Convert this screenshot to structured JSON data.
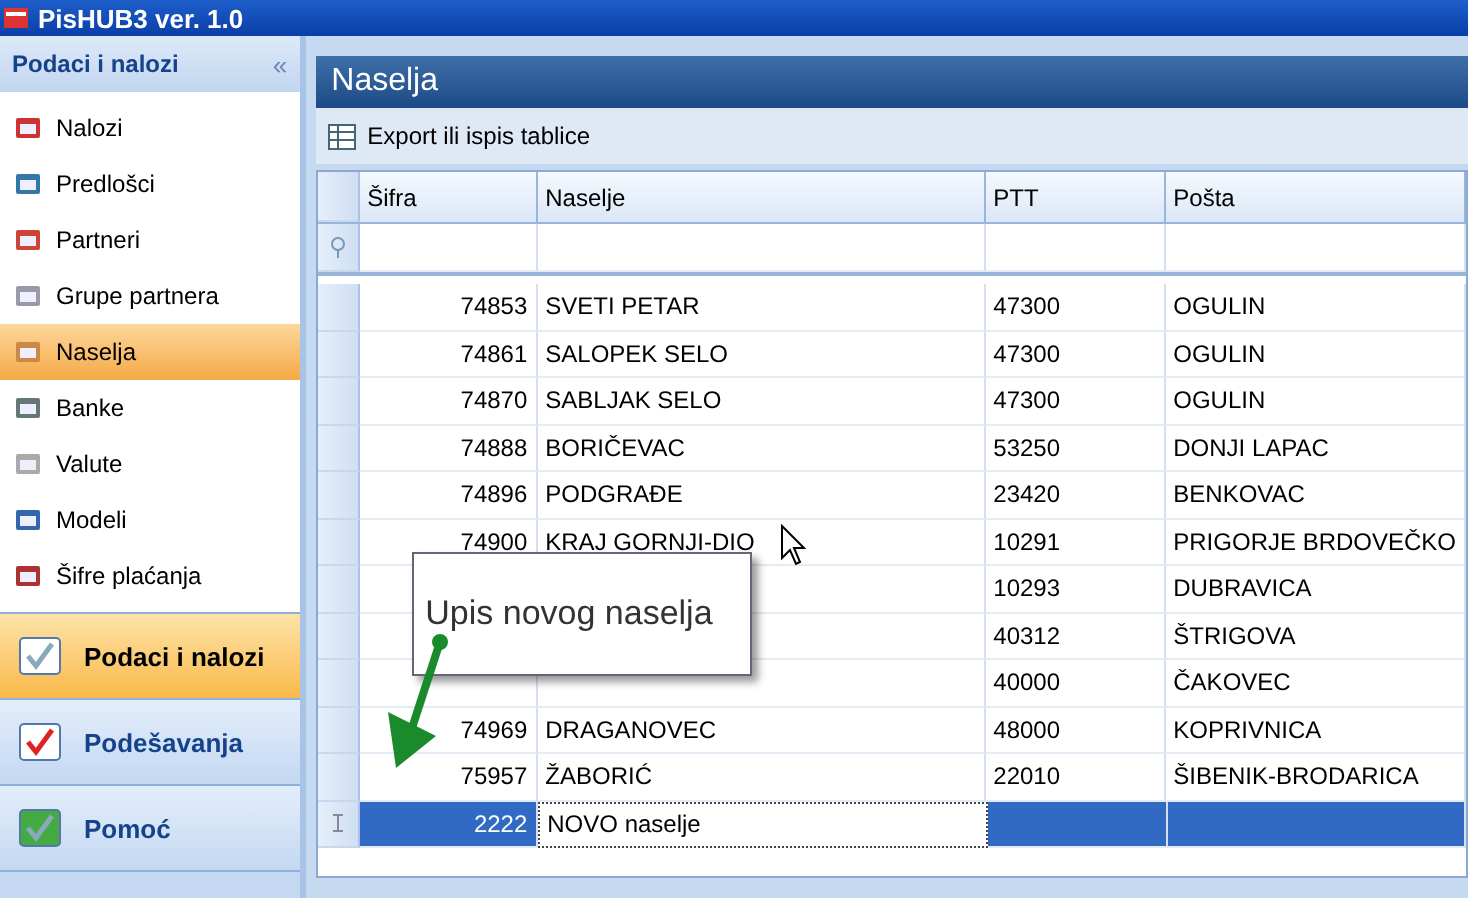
{
  "app": {
    "title": "PisHUB3 ver. 1.0"
  },
  "sidebar": {
    "header": "Podaci i nalozi",
    "collapse": "«",
    "items": [
      {
        "label": "Nalozi",
        "selected": false
      },
      {
        "label": "Predlošci",
        "selected": false
      },
      {
        "label": "Partneri",
        "selected": false
      },
      {
        "label": "Grupe partnera",
        "selected": false
      },
      {
        "label": "Naselja",
        "selected": true
      },
      {
        "label": "Banke",
        "selected": false
      },
      {
        "label": "Valute",
        "selected": false
      },
      {
        "label": "Modeli",
        "selected": false
      },
      {
        "label": "Šifre plaćanja",
        "selected": false
      }
    ],
    "sections": [
      {
        "label": "Podaci i nalozi",
        "selected": true
      },
      {
        "label": "Podešavanja",
        "selected": false
      },
      {
        "label": "Pomoć",
        "selected": false
      }
    ]
  },
  "panel": {
    "title": "Naselja",
    "export": "Export ili ispis tablice"
  },
  "table": {
    "columns": [
      "Šifra",
      "Naselje",
      "PTT",
      "Pošta"
    ],
    "rows": [
      {
        "sifra": "74853",
        "naselje": "SVETI PETAR",
        "ptt": "47300",
        "posta": "OGULIN",
        "selected": false
      },
      {
        "sifra": "74861",
        "naselje": "SALOPEK SELO",
        "ptt": "47300",
        "posta": "OGULIN",
        "selected": false
      },
      {
        "sifra": "74870",
        "naselje": "SABLJAK SELO",
        "ptt": "47300",
        "posta": "OGULIN",
        "selected": false
      },
      {
        "sifra": "74888",
        "naselje": "BORIČEVAC",
        "ptt": "53250",
        "posta": "DONJI LAPAC",
        "selected": false
      },
      {
        "sifra": "74896",
        "naselje": "PODGRAĐE",
        "ptt": "23420",
        "posta": "BENKOVAC",
        "selected": false
      },
      {
        "sifra": "74900",
        "naselje": "KRAJ GORNJI-DIO",
        "ptt": "10291",
        "posta": "PRIGORJE BRDOVEČKO",
        "selected": false
      },
      {
        "ptt": "10293",
        "posta": "DUBRAVICA",
        "selected": false
      },
      {
        "ptt": "40312",
        "posta": "ŠTRIGOVA",
        "selected": false
      },
      {
        "ptt": "40000",
        "posta": "ČAKOVEC",
        "selected": false
      },
      {
        "sifra": "74969",
        "naselje": "DRAGANOVEC",
        "ptt": "48000",
        "posta": "KOPRIVNICA",
        "selected": false
      },
      {
        "sifra": "75957",
        "naselje": "ŽABORIĆ",
        "ptt": "22010",
        "posta": "ŠIBENIK-BRODARICA",
        "selected": false
      },
      {
        "sifra": "2222",
        "naselje": "NOVO naselje",
        "selected": true
      }
    ]
  },
  "callout": {
    "text": "Upis novog naselja"
  }
}
